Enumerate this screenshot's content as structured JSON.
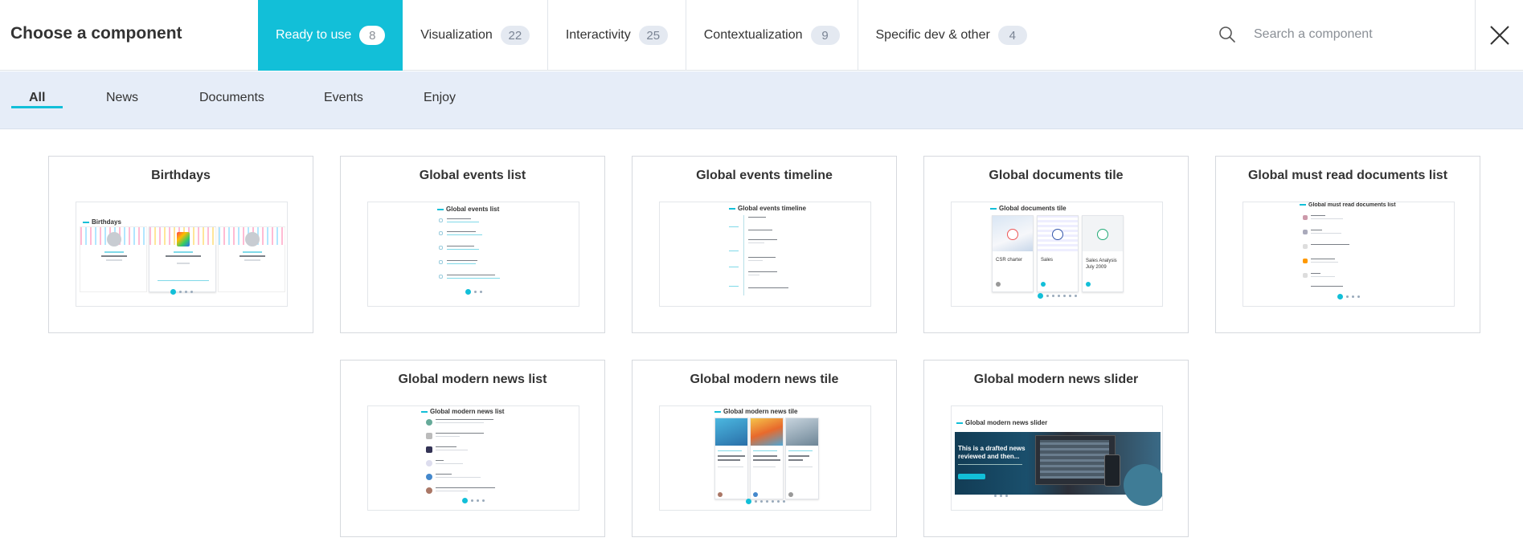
{
  "header": {
    "title": "Choose a component",
    "tabs": [
      {
        "label": "Ready to use",
        "count": "8"
      },
      {
        "label": "Visualization",
        "count": "22"
      },
      {
        "label": "Interactivity",
        "count": "25"
      },
      {
        "label": "Contextualization",
        "count": "9"
      },
      {
        "label": "Specific dev & other",
        "count": "4"
      }
    ],
    "search_placeholder": "Search a component"
  },
  "subnav": {
    "items": [
      "All",
      "News",
      "Documents",
      "Events",
      "Enjoy"
    ]
  },
  "cards": [
    {
      "title": "Birthdays",
      "preview_title": "Birthdays"
    },
    {
      "title": "Global events list",
      "preview_title": "Global events list"
    },
    {
      "title": "Global events timeline",
      "preview_title": "Global events timeline"
    },
    {
      "title": "Global documents tile",
      "preview_title": "Global documents tile"
    },
    {
      "title": "Global must read documents list",
      "preview_title": "Global must read documents list"
    },
    {
      "title": "Global modern news list",
      "preview_title": "Global modern news list"
    },
    {
      "title": "Global modern news tile",
      "preview_title": "Global modern news tile"
    },
    {
      "title": "Global modern news slider",
      "preview_title": "Global modern news slider"
    }
  ],
  "previews": {
    "documents_tile": {
      "doc1": "CSR charter",
      "doc2": "Sales",
      "doc3": "Sales Analysis July 2009"
    },
    "news_slider": {
      "headline": "This is a drafted news reviewed and then..."
    }
  },
  "colors": {
    "accent": "#12bfd8",
    "subnav_bg": "#e6edf8",
    "badge_bg": "#e4e9f1"
  }
}
